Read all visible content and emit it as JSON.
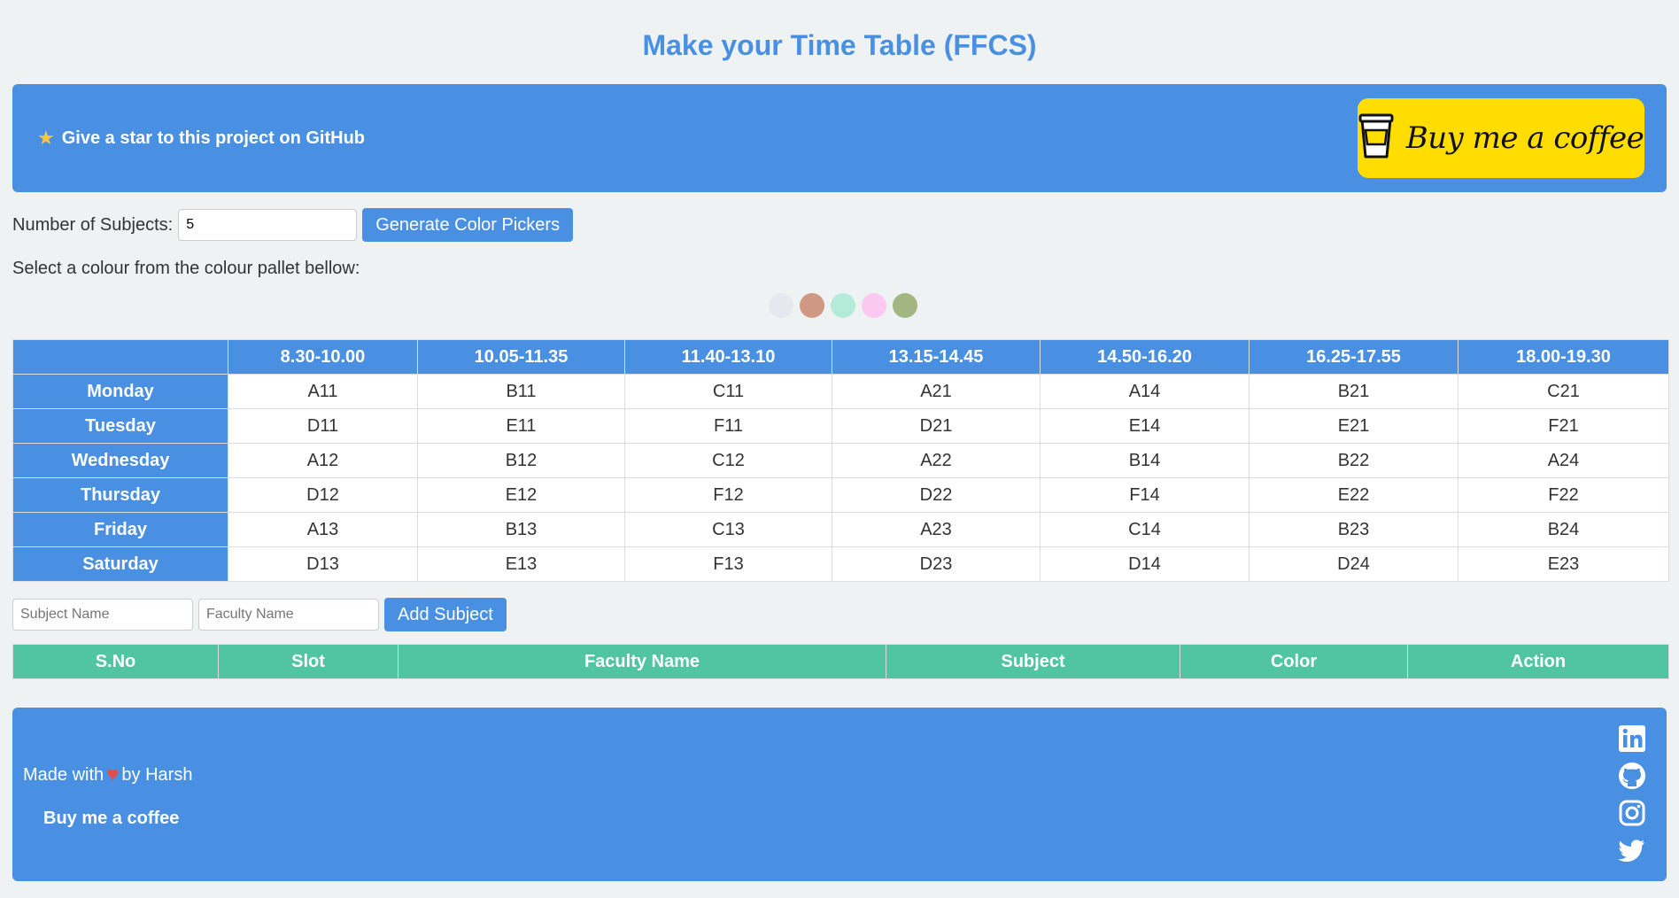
{
  "page": {
    "title": "Make your Time Table (FFCS)"
  },
  "banner": {
    "star_label": "Give a star to this project on GitHub",
    "coffee_label": "Buy me a coffee"
  },
  "controls": {
    "subjects_label": "Number of Subjects:",
    "subjects_value": "5",
    "generate_label": "Generate Color Pickers"
  },
  "palette": {
    "hint": "Select a colour from the colour pallet bellow:",
    "colors": [
      "#e6e8ef",
      "#cf9784",
      "#b4ead8",
      "#fbc8f2",
      "#a3b681"
    ]
  },
  "timetable": {
    "times": [
      "8.30-10.00",
      "10.05-11.35",
      "11.40-13.10",
      "13.15-14.45",
      "14.50-16.20",
      "16.25-17.55",
      "18.00-19.30"
    ],
    "rows": [
      {
        "day": "Monday",
        "slots": [
          "A11",
          "B11",
          "C11",
          "A21",
          "A14",
          "B21",
          "C21"
        ]
      },
      {
        "day": "Tuesday",
        "slots": [
          "D11",
          "E11",
          "F11",
          "D21",
          "E14",
          "E21",
          "F21"
        ]
      },
      {
        "day": "Wednesday",
        "slots": [
          "A12",
          "B12",
          "C12",
          "A22",
          "B14",
          "B22",
          "A24"
        ]
      },
      {
        "day": "Thursday",
        "slots": [
          "D12",
          "E12",
          "F12",
          "D22",
          "F14",
          "E22",
          "F22"
        ]
      },
      {
        "day": "Friday",
        "slots": [
          "A13",
          "B13",
          "C13",
          "A23",
          "C14",
          "B23",
          "B24"
        ]
      },
      {
        "day": "Saturday",
        "slots": [
          "D13",
          "E13",
          "F13",
          "D23",
          "D14",
          "D24",
          "E23"
        ]
      }
    ]
  },
  "add_subject": {
    "subject_placeholder": "Subject Name",
    "faculty_placeholder": "Faculty Name",
    "button_label": "Add Subject"
  },
  "subjects_table": {
    "headers": [
      "S.No",
      "Slot",
      "Faculty Name",
      "Subject",
      "Color",
      "Action"
    ]
  },
  "footer": {
    "made_with": "Made with",
    "by": "by Harsh",
    "coffee_label": "Buy me a coffee"
  },
  "colors": {
    "primary": "#4a90e2",
    "accent_green": "#50c5a0",
    "coffee_yellow": "#ffdd00",
    "heart": "#e94b4b"
  }
}
